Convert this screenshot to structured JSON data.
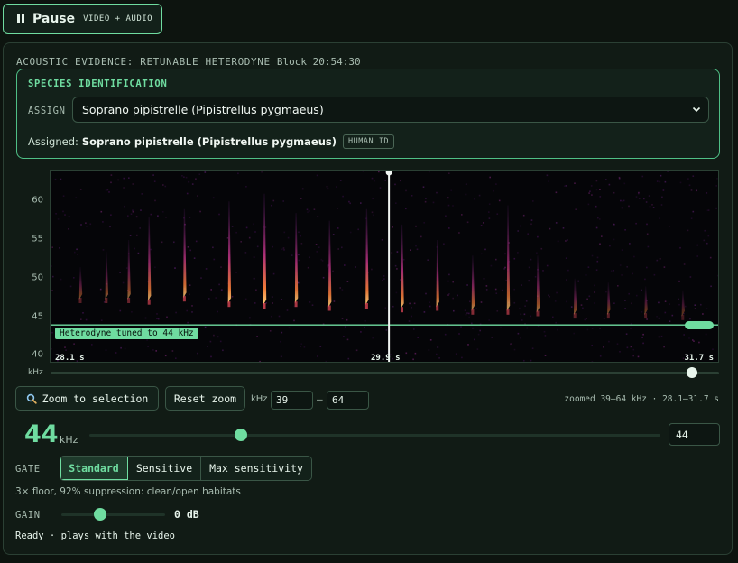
{
  "playback": {
    "label": "Pause",
    "sublabel": "VIDEO + AUDIO",
    "icon": "pause-icon"
  },
  "evidence": {
    "title": "ACOUSTIC EVIDENCE: RETUNABLE HETERODYNE",
    "block": "Block 20:54:30"
  },
  "species": {
    "title": "SPECIES IDENTIFICATION",
    "assign_label": "ASSIGN",
    "selected": "Soprano pipistrelle (Pipistrellus pygmaeus)",
    "assigned_prefix": "Assigned:",
    "assigned_value": "Soprano pipistrelle (Pipistrellus pygmaeus)",
    "assigned_badge": "HUMAN ID"
  },
  "spectrogram": {
    "y_ticks": [
      "60",
      "55",
      "50",
      "45",
      "40"
    ],
    "y_tick_values": [
      60,
      55,
      50,
      45,
      40
    ],
    "y_range": [
      39,
      64
    ],
    "y_unit": "kHz",
    "time_start": "28.1 s",
    "time_mid": "29.9 s",
    "time_end": "31.7 s",
    "time_range": [
      28.1,
      31.7
    ],
    "tuned_label": "Heterodyne tuned to 44 kHz",
    "tuned_khz": 44,
    "playhead_s": 29.92,
    "scrub_fraction": 0.96,
    "calls": [
      {
        "t": 28.26,
        "top": 51.5,
        "peak": 48.0,
        "i": 0.45
      },
      {
        "t": 28.4,
        "top": 53.5,
        "peak": 48.0,
        "i": 0.5
      },
      {
        "t": 28.52,
        "top": 55.0,
        "peak": 48.0,
        "i": 0.55
      },
      {
        "t": 28.63,
        "top": 58.0,
        "peak": 47.8,
        "i": 0.8
      },
      {
        "t": 28.82,
        "top": 59.0,
        "peak": 48.2,
        "i": 0.85
      },
      {
        "t": 29.06,
        "top": 60.0,
        "peak": 47.5,
        "i": 0.95
      },
      {
        "t": 29.25,
        "top": 61.0,
        "peak": 47.3,
        "i": 1.0
      },
      {
        "t": 29.42,
        "top": 58.5,
        "peak": 47.5,
        "i": 0.9
      },
      {
        "t": 29.6,
        "top": 57.5,
        "peak": 47.0,
        "i": 0.9
      },
      {
        "t": 29.8,
        "top": 59.0,
        "peak": 47.3,
        "i": 0.95
      },
      {
        "t": 29.99,
        "top": 57.0,
        "peak": 46.8,
        "i": 0.9
      },
      {
        "t": 30.18,
        "top": 55.0,
        "peak": 47.0,
        "i": 0.8
      },
      {
        "t": 30.37,
        "top": 53.0,
        "peak": 46.5,
        "i": 0.7
      },
      {
        "t": 30.56,
        "top": 59.5,
        "peak": 46.5,
        "i": 0.75
      },
      {
        "t": 30.72,
        "top": 53.0,
        "peak": 46.3,
        "i": 0.6
      },
      {
        "t": 30.92,
        "top": 50.0,
        "peak": 46.0,
        "i": 0.5
      },
      {
        "t": 31.1,
        "top": 49.5,
        "peak": 46.0,
        "i": 0.45
      },
      {
        "t": 31.3,
        "top": 49.0,
        "peak": 46.0,
        "i": 0.4
      },
      {
        "t": 31.5,
        "top": 48.5,
        "peak": 45.8,
        "i": 0.35
      }
    ]
  },
  "zoom": {
    "zoom_button": "Zoom to selection",
    "zoom_icon": "magnifier-icon",
    "reset_button": "Reset zoom",
    "khz_label": "kHz",
    "low": "39",
    "dash": "–",
    "high": "64",
    "readout": "zoomed 39–64 kHz · 28.1–31.7 s"
  },
  "tuning": {
    "value_big": "44",
    "unit": "kHz",
    "input_value": "44",
    "slider_fraction": 0.265
  },
  "gate": {
    "label": "GATE",
    "options": [
      "Standard",
      "Sensitive",
      "Max sensitivity"
    ],
    "selected": "Standard",
    "description": "3× floor, 92% suppression: clean/open habitats"
  },
  "gain": {
    "label": "GAIN",
    "value": "0 dB",
    "slider_fraction": 0.37
  },
  "status": "Ready · plays with the video",
  "colors": {
    "accent": "#6fdca0",
    "background": "#0d140f",
    "panel": "#111b15",
    "spectro_bg": "#050508"
  }
}
